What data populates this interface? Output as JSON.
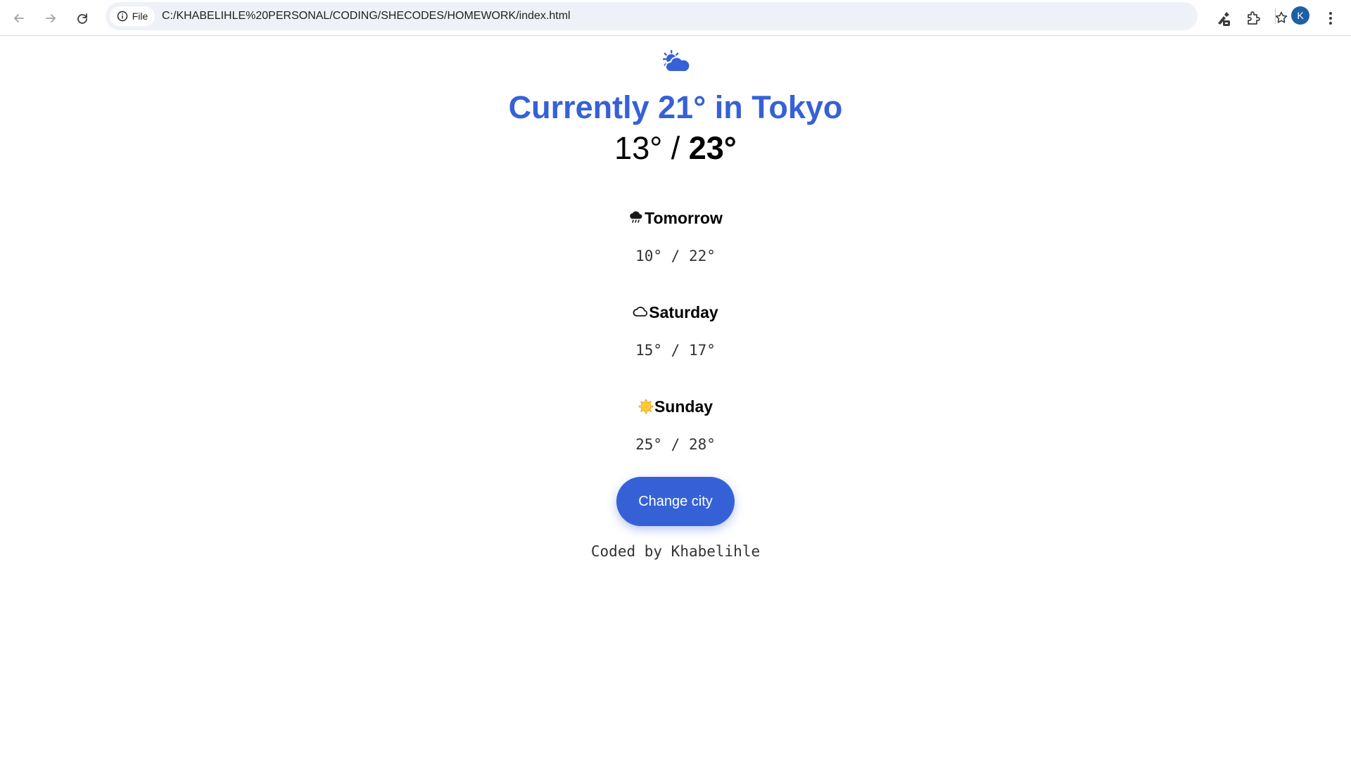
{
  "browser": {
    "site_chip_label": "File",
    "url": "C:/KHABELIHLE%20PERSONAL/CODING/SHECODES/HOMEWORK/index.html",
    "profile_initial": "K"
  },
  "current": {
    "icon": "partly-cloudy-icon",
    "headline": "Currently 21° in Tokyo",
    "low": "13°",
    "separator": " / ",
    "high": "23°"
  },
  "forecast": [
    {
      "icon": "rain-cloud-icon",
      "day": "Tomorrow",
      "temps": "10° / 22°"
    },
    {
      "icon": "cloud-icon",
      "day": "Saturday",
      "temps": "15° / 17°"
    },
    {
      "icon": "sun-icon",
      "day": "Sunday",
      "temps": "25° / 28°"
    }
  ],
  "change_city_label": "Change city",
  "footer": "Coded by Khabelihle",
  "colors": {
    "accent": "#3661d6",
    "avatar": "#1e5fa8"
  }
}
